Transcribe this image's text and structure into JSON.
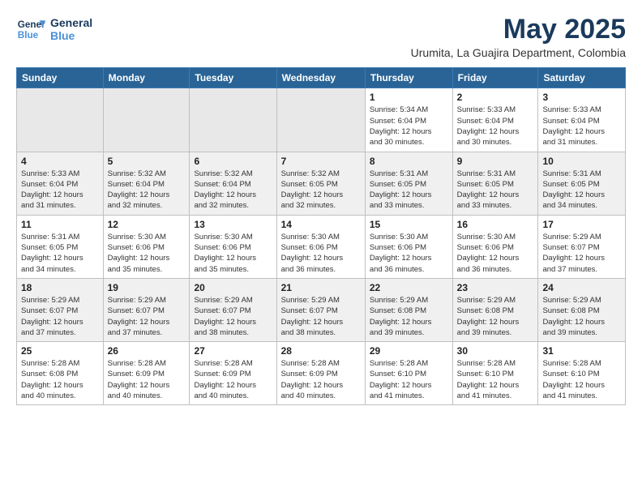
{
  "header": {
    "logo_line1": "General",
    "logo_line2": "Blue",
    "month_title": "May 2025",
    "subtitle": "Urumita, La Guajira Department, Colombia"
  },
  "days_of_week": [
    "Sunday",
    "Monday",
    "Tuesday",
    "Wednesday",
    "Thursday",
    "Friday",
    "Saturday"
  ],
  "weeks": [
    [
      {
        "day": "",
        "info": ""
      },
      {
        "day": "",
        "info": ""
      },
      {
        "day": "",
        "info": ""
      },
      {
        "day": "",
        "info": ""
      },
      {
        "day": "1",
        "info": "Sunrise: 5:34 AM\nSunset: 6:04 PM\nDaylight: 12 hours\nand 30 minutes."
      },
      {
        "day": "2",
        "info": "Sunrise: 5:33 AM\nSunset: 6:04 PM\nDaylight: 12 hours\nand 30 minutes."
      },
      {
        "day": "3",
        "info": "Sunrise: 5:33 AM\nSunset: 6:04 PM\nDaylight: 12 hours\nand 31 minutes."
      }
    ],
    [
      {
        "day": "4",
        "info": "Sunrise: 5:33 AM\nSunset: 6:04 PM\nDaylight: 12 hours\nand 31 minutes."
      },
      {
        "day": "5",
        "info": "Sunrise: 5:32 AM\nSunset: 6:04 PM\nDaylight: 12 hours\nand 32 minutes."
      },
      {
        "day": "6",
        "info": "Sunrise: 5:32 AM\nSunset: 6:04 PM\nDaylight: 12 hours\nand 32 minutes."
      },
      {
        "day": "7",
        "info": "Sunrise: 5:32 AM\nSunset: 6:05 PM\nDaylight: 12 hours\nand 32 minutes."
      },
      {
        "day": "8",
        "info": "Sunrise: 5:31 AM\nSunset: 6:05 PM\nDaylight: 12 hours\nand 33 minutes."
      },
      {
        "day": "9",
        "info": "Sunrise: 5:31 AM\nSunset: 6:05 PM\nDaylight: 12 hours\nand 33 minutes."
      },
      {
        "day": "10",
        "info": "Sunrise: 5:31 AM\nSunset: 6:05 PM\nDaylight: 12 hours\nand 34 minutes."
      }
    ],
    [
      {
        "day": "11",
        "info": "Sunrise: 5:31 AM\nSunset: 6:05 PM\nDaylight: 12 hours\nand 34 minutes."
      },
      {
        "day": "12",
        "info": "Sunrise: 5:30 AM\nSunset: 6:06 PM\nDaylight: 12 hours\nand 35 minutes."
      },
      {
        "day": "13",
        "info": "Sunrise: 5:30 AM\nSunset: 6:06 PM\nDaylight: 12 hours\nand 35 minutes."
      },
      {
        "day": "14",
        "info": "Sunrise: 5:30 AM\nSunset: 6:06 PM\nDaylight: 12 hours\nand 36 minutes."
      },
      {
        "day": "15",
        "info": "Sunrise: 5:30 AM\nSunset: 6:06 PM\nDaylight: 12 hours\nand 36 minutes."
      },
      {
        "day": "16",
        "info": "Sunrise: 5:30 AM\nSunset: 6:06 PM\nDaylight: 12 hours\nand 36 minutes."
      },
      {
        "day": "17",
        "info": "Sunrise: 5:29 AM\nSunset: 6:07 PM\nDaylight: 12 hours\nand 37 minutes."
      }
    ],
    [
      {
        "day": "18",
        "info": "Sunrise: 5:29 AM\nSunset: 6:07 PM\nDaylight: 12 hours\nand 37 minutes."
      },
      {
        "day": "19",
        "info": "Sunrise: 5:29 AM\nSunset: 6:07 PM\nDaylight: 12 hours\nand 37 minutes."
      },
      {
        "day": "20",
        "info": "Sunrise: 5:29 AM\nSunset: 6:07 PM\nDaylight: 12 hours\nand 38 minutes."
      },
      {
        "day": "21",
        "info": "Sunrise: 5:29 AM\nSunset: 6:07 PM\nDaylight: 12 hours\nand 38 minutes."
      },
      {
        "day": "22",
        "info": "Sunrise: 5:29 AM\nSunset: 6:08 PM\nDaylight: 12 hours\nand 39 minutes."
      },
      {
        "day": "23",
        "info": "Sunrise: 5:29 AM\nSunset: 6:08 PM\nDaylight: 12 hours\nand 39 minutes."
      },
      {
        "day": "24",
        "info": "Sunrise: 5:29 AM\nSunset: 6:08 PM\nDaylight: 12 hours\nand 39 minutes."
      }
    ],
    [
      {
        "day": "25",
        "info": "Sunrise: 5:28 AM\nSunset: 6:08 PM\nDaylight: 12 hours\nand 40 minutes."
      },
      {
        "day": "26",
        "info": "Sunrise: 5:28 AM\nSunset: 6:09 PM\nDaylight: 12 hours\nand 40 minutes."
      },
      {
        "day": "27",
        "info": "Sunrise: 5:28 AM\nSunset: 6:09 PM\nDaylight: 12 hours\nand 40 minutes."
      },
      {
        "day": "28",
        "info": "Sunrise: 5:28 AM\nSunset: 6:09 PM\nDaylight: 12 hours\nand 40 minutes."
      },
      {
        "day": "29",
        "info": "Sunrise: 5:28 AM\nSunset: 6:10 PM\nDaylight: 12 hours\nand 41 minutes."
      },
      {
        "day": "30",
        "info": "Sunrise: 5:28 AM\nSunset: 6:10 PM\nDaylight: 12 hours\nand 41 minutes."
      },
      {
        "day": "31",
        "info": "Sunrise: 5:28 AM\nSunset: 6:10 PM\nDaylight: 12 hours\nand 41 minutes."
      }
    ]
  ]
}
